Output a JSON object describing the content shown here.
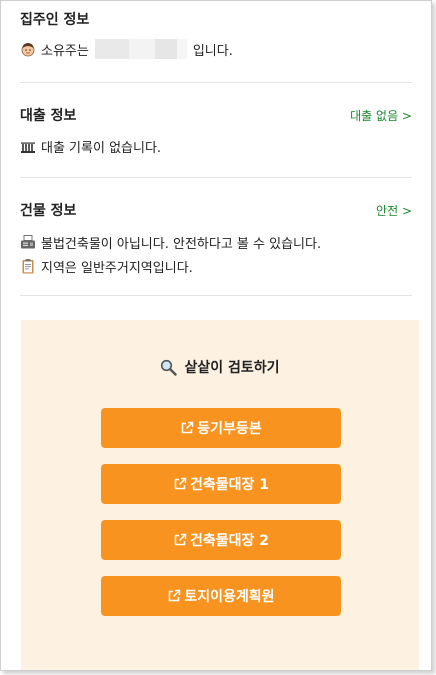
{
  "owner_section": {
    "title": "집주인 정보",
    "text_before": "소유주는",
    "text_after": "입니다.",
    "icon": "person-face-icon"
  },
  "loan_section": {
    "title": "대출 정보",
    "link": "대출 없음 >",
    "text": "대출 기록이 없습니다.",
    "icon": "bank-icon"
  },
  "building_section": {
    "title": "건물 정보",
    "link": "안전 >",
    "lines": [
      {
        "icon": "fax-icon",
        "text": "불법건축물이 아닙니다. 안전하다고 볼 수 있습니다."
      },
      {
        "icon": "clipboard-icon",
        "text": "지역은 일반주거지역입니다."
      }
    ]
  },
  "review": {
    "title": "샅샅이 검토하기",
    "icon": "magnifier-icon",
    "buttons": [
      "등기부등본",
      "건축물대장 1",
      "건축물대장 2",
      "토지이용계획원"
    ],
    "button_icon": "external-link-icon"
  },
  "colors": {
    "accent": "#f7931e",
    "link_green": "#1a8a2e",
    "review_bg": "#fdf1e2"
  }
}
